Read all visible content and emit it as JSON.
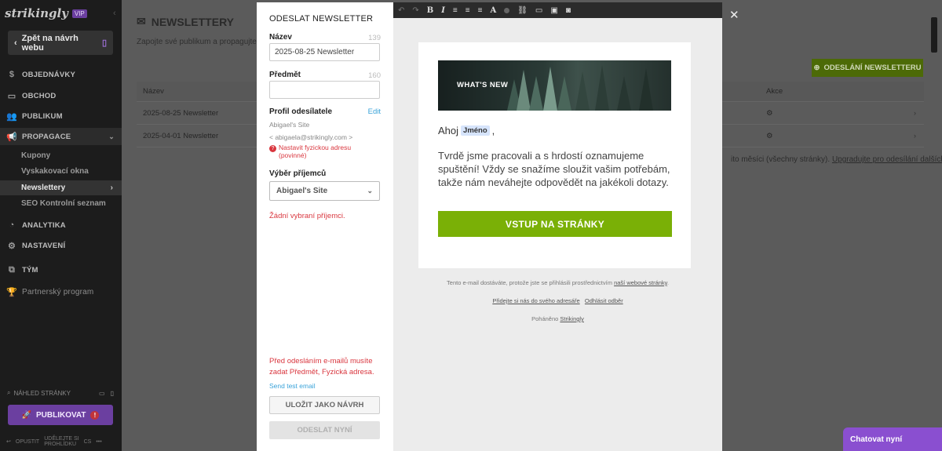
{
  "sidebar": {
    "logo": "strikingly",
    "vip": "VIP",
    "back_label": "Zpět na návrh webu",
    "nav": {
      "orders": "OBJEDNÁVKY",
      "store": "OBCHOD",
      "audience": "PUBLIKUM",
      "promotion": "PROPAGACE",
      "analytics": "ANALYTIKA",
      "settings": "NASTAVENÍ",
      "team": "TÝM",
      "partner": "Partnerský program"
    },
    "sub": {
      "coupons": "Kupony",
      "popups": "Vyskakovací okna",
      "newsletters": "Newslettery",
      "seo": "SEO Kontrolní seznam"
    },
    "preview_label": "NÁHLED STRÁNKY",
    "publish_label": "PUBLIKOVAT",
    "bottom": {
      "leave": "OPUSTIT",
      "upgrade_line1": "UDĚLEJTE SI",
      "upgrade_line2": "PROHLÍDKU",
      "lang": "CS",
      "more": "•••"
    }
  },
  "main": {
    "title": "NEWSLETTERY",
    "subtitle": "Zapojte své publikum a propagujte s",
    "send_button": "ODESLÁNÍ NEWSLETTERU",
    "table": {
      "col_name": "Název",
      "col_action": "Akce",
      "rows": [
        {
          "name": "2025-08-25 Newsletter"
        },
        {
          "name": "2025-04-01 Newsletter"
        }
      ]
    },
    "footnote_text": "ito měsíci (všechny stránky).",
    "footnote_link": "Upgradujte pro odesílání dalších"
  },
  "form": {
    "heading": "ODESLAT NEWSLETTER",
    "name_label": "Název",
    "name_count": "139",
    "name_value": "2025-08-25 Newsletter",
    "subject_label": "Předmět",
    "subject_count": "160",
    "subject_value": "",
    "profile_label": "Profil odesílatele",
    "profile_edit": "Edit",
    "profile_name": "Abigael's Site",
    "profile_email": "< abigaela@strikingly.com >",
    "address_error_line1": "Nastavit fyzickou adresu",
    "address_error_line2": "(povinné)",
    "recipients_label": "Výběr příjemců",
    "recipients_value": "Abigael's Site",
    "no_recipients": "Žádní vybraní příjemci.",
    "warning_line1": "Před odesláním e-mailů musíte",
    "warning_line2": "zadat Předmět, Fyzická adresa.",
    "test_link": "Send test email",
    "save_draft": "ULOŽIT JAKO NÁVRH",
    "send_now": "ODESLAT NYNÍ"
  },
  "toolbar": {
    "undo": "↶",
    "redo": "↷",
    "bold": "B",
    "italic": "I",
    "align_left": "≡",
    "align_center": "≡",
    "align_right": "≡",
    "font_color": "A"
  },
  "preview": {
    "banner_text": "WHAT'S NEW",
    "greeting": "Ahoj",
    "name_tag": "Jméno",
    "greeting_end": ",",
    "body": "Tvrdě jsme pracovali a s hrdostí oznamujeme spuštění! Vždy se snažíme sloužit vašim potřebám, takže nám neváhejte odpovědět na jakékoli dotazy.",
    "cta": "VSTUP NA STRÁNKY",
    "footer_text": "Tento e-mail dostáváte, protože jste se přihlásili prostřednictvím",
    "footer_link": "naší webové stránky",
    "footer_period": ".",
    "add_address": "Přidejte si nás do svého adresáře",
    "unsubscribe": "Odhlásit odběr",
    "powered_text": "Poháněno",
    "powered_link": "Strikingly"
  },
  "chat": {
    "label": "Chatovat nyní"
  },
  "colors": {
    "accent_green": "#7ab006",
    "brand_purple": "#6b3fa0",
    "error_red": "#d9363e",
    "link_blue": "#3aa3d9"
  }
}
